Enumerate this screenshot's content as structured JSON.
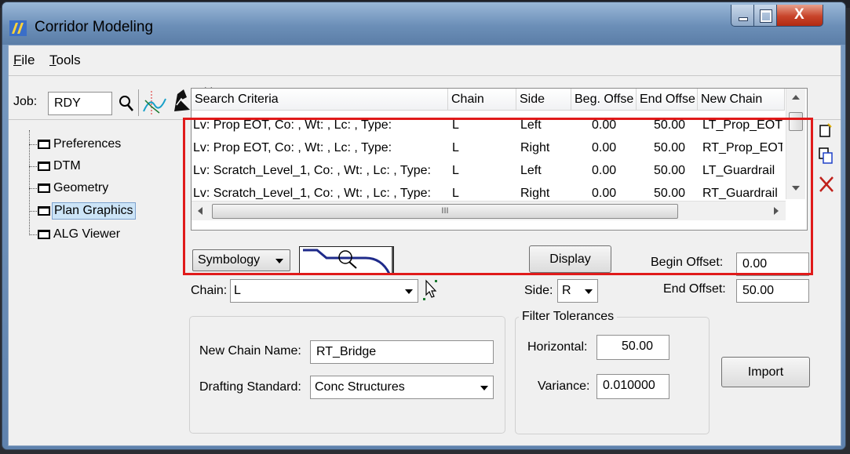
{
  "window": {
    "title": "Corridor Modeling",
    "controls": {
      "minimize": "minimize",
      "maximize": "maximize",
      "close": "X"
    }
  },
  "menu": {
    "file": "File",
    "file_key": "F",
    "file_rest": "ile",
    "tools_key": "T",
    "tools_rest": "ools"
  },
  "job": {
    "label": "Job:",
    "value": "RDY"
  },
  "toolbar_icons": [
    "search-icon",
    "alignment-icon",
    "surface-icon",
    "template-icon",
    "roadway-icon",
    "drafting-icon"
  ],
  "tree": {
    "items": [
      "Preferences",
      "DTM",
      "Geometry",
      "Plan Graphics",
      "ALG Viewer"
    ],
    "selected": "Plan Graphics"
  },
  "table": {
    "headers": [
      "Search Criteria",
      "Chain",
      "Side",
      "Beg. Offse",
      "End Offse",
      "New Chain"
    ],
    "rows": [
      [
        "Lv: Prop EOT, Co: , Wt: , Lc: , Type:",
        "L",
        "Left",
        "0.00",
        "50.00",
        "LT_Prop_EOT"
      ],
      [
        "Lv: Prop EOT, Co: , Wt: , Lc: , Type:",
        "L",
        "Right",
        "0.00",
        "50.00",
        "RT_Prop_EOT"
      ],
      [
        "Lv: Scratch_Level_1, Co: , Wt: , Lc: , Type:",
        "L",
        "Left",
        "0.00",
        "50.00",
        "LT_Guardrail"
      ],
      [
        "Lv: Scratch_Level_1, Co: , Wt: , Lc: , Type:",
        "L",
        "Right",
        "0.00",
        "50.00",
        "RT_Guardrail"
      ]
    ],
    "hscroll_grip": "III"
  },
  "controls": {
    "symbology": "Symbology",
    "display": "Display",
    "begin_offset_label": "Begin Offset:",
    "begin_offset_value": "0.00",
    "end_offset_label": "End Offset:",
    "end_offset_value": "50.00",
    "chain_label": "Chain:",
    "chain_value": "L",
    "side_label": "Side:",
    "side_value": "R"
  },
  "chain_group": {
    "new_chain_label": "New Chain Name:",
    "new_chain_value": "RT_Bridge",
    "drafting_label": "Drafting Standard:",
    "drafting_value": "Conc Structures"
  },
  "filter": {
    "title": "Filter Tolerances",
    "horizontal_label": "Horizontal:",
    "horizontal_value": "50.00",
    "variance_label": "Variance:",
    "variance_value": "0.010000"
  },
  "import_label": "Import",
  "colors": {
    "highlight": "#e01a1a",
    "title_bar": "#6c8fb8",
    "selected_bg": "#cce4f7"
  }
}
